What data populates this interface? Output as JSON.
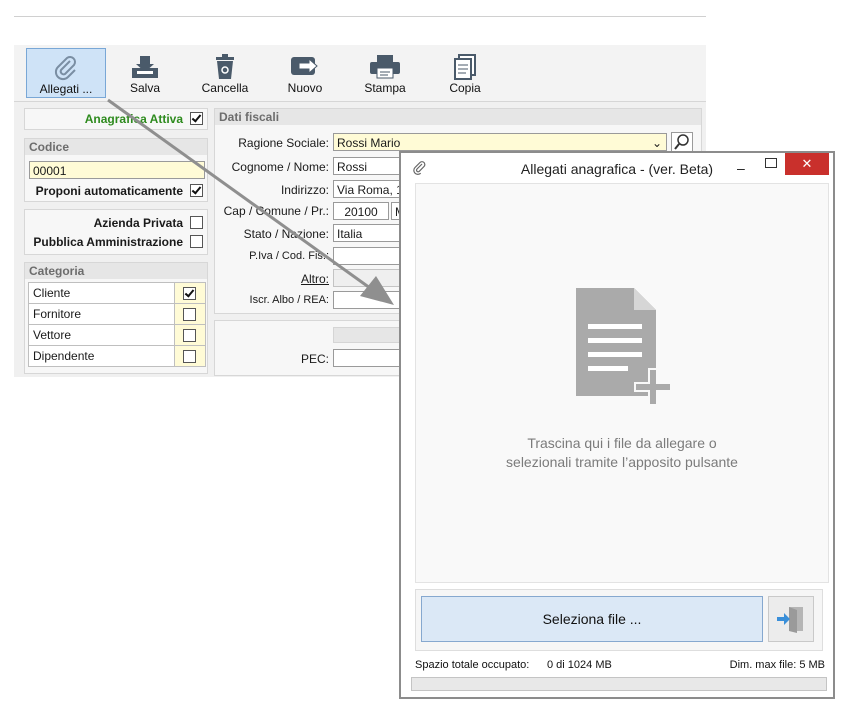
{
  "toolbar": {
    "buttons": [
      {
        "label": "Allegati ...",
        "icon": "paperclip-icon"
      },
      {
        "label": "Salva",
        "icon": "save-download-icon"
      },
      {
        "label": "Cancella",
        "icon": "trash-icon"
      },
      {
        "label": "Nuovo",
        "icon": "new-arrow-icon"
      },
      {
        "label": "Stampa",
        "icon": "printer-icon"
      },
      {
        "label": "Copia",
        "icon": "copy-document-icon"
      }
    ]
  },
  "left": {
    "anagrafica_attiva": {
      "label": "Anagrafica Attiva",
      "checked": true
    },
    "codice": {
      "title": "Codice",
      "value": "00001"
    },
    "proponi": {
      "label": "Proponi automaticamente",
      "checked": true
    },
    "azienda_privata": {
      "label": "Azienda Privata",
      "checked": false
    },
    "pubblica_amm": {
      "label": "Pubblica Amministrazione",
      "checked": false
    },
    "categoria": {
      "title": "Categoria",
      "items": [
        {
          "label": "Cliente",
          "checked": true
        },
        {
          "label": "Fornitore",
          "checked": false
        },
        {
          "label": "Vettore",
          "checked": false
        },
        {
          "label": "Dipendente",
          "checked": false
        }
      ]
    }
  },
  "fiscali": {
    "title": "Dati fiscali",
    "ragione_sociale": {
      "label": "Ragione Sociale:",
      "value": "Rossi Mario"
    },
    "cognome_nome": {
      "label": "Cognome / Nome:",
      "value": "Rossi"
    },
    "indirizzo": {
      "label": "Indirizzo:",
      "value": "Via Roma, 1"
    },
    "cap": {
      "label": "Cap / Comune / Pr.:",
      "cap": "20100",
      "comune": "M"
    },
    "stato": {
      "label": "Stato / Nazione:",
      "value": "Italia"
    },
    "piva": {
      "label": "P.Iva / Cod. Fis.:",
      "value": ""
    },
    "altro": {
      "label": "Altro:"
    },
    "albo": {
      "label": "Iscr. Albo / REA:",
      "value": ""
    },
    "pec": {
      "label": "PEC:",
      "value": ""
    }
  },
  "dialog": {
    "title": "Allegati anagrafica - (ver. Beta)",
    "drop_line1": "Trascina qui i file da allegare o",
    "drop_line2": "selezionali tramite l’apposito pulsante",
    "select_button": "Seleziona file ...",
    "status_left": "Spazio totale occupato:",
    "status_value": "0 di 1024 MB",
    "status_right": "Dim. max file: 5 MB",
    "progress": 0
  },
  "colors": {
    "active_green": "#2e8b1e",
    "close_red": "#c9302c",
    "accent_blue": "#cfe3f7"
  }
}
